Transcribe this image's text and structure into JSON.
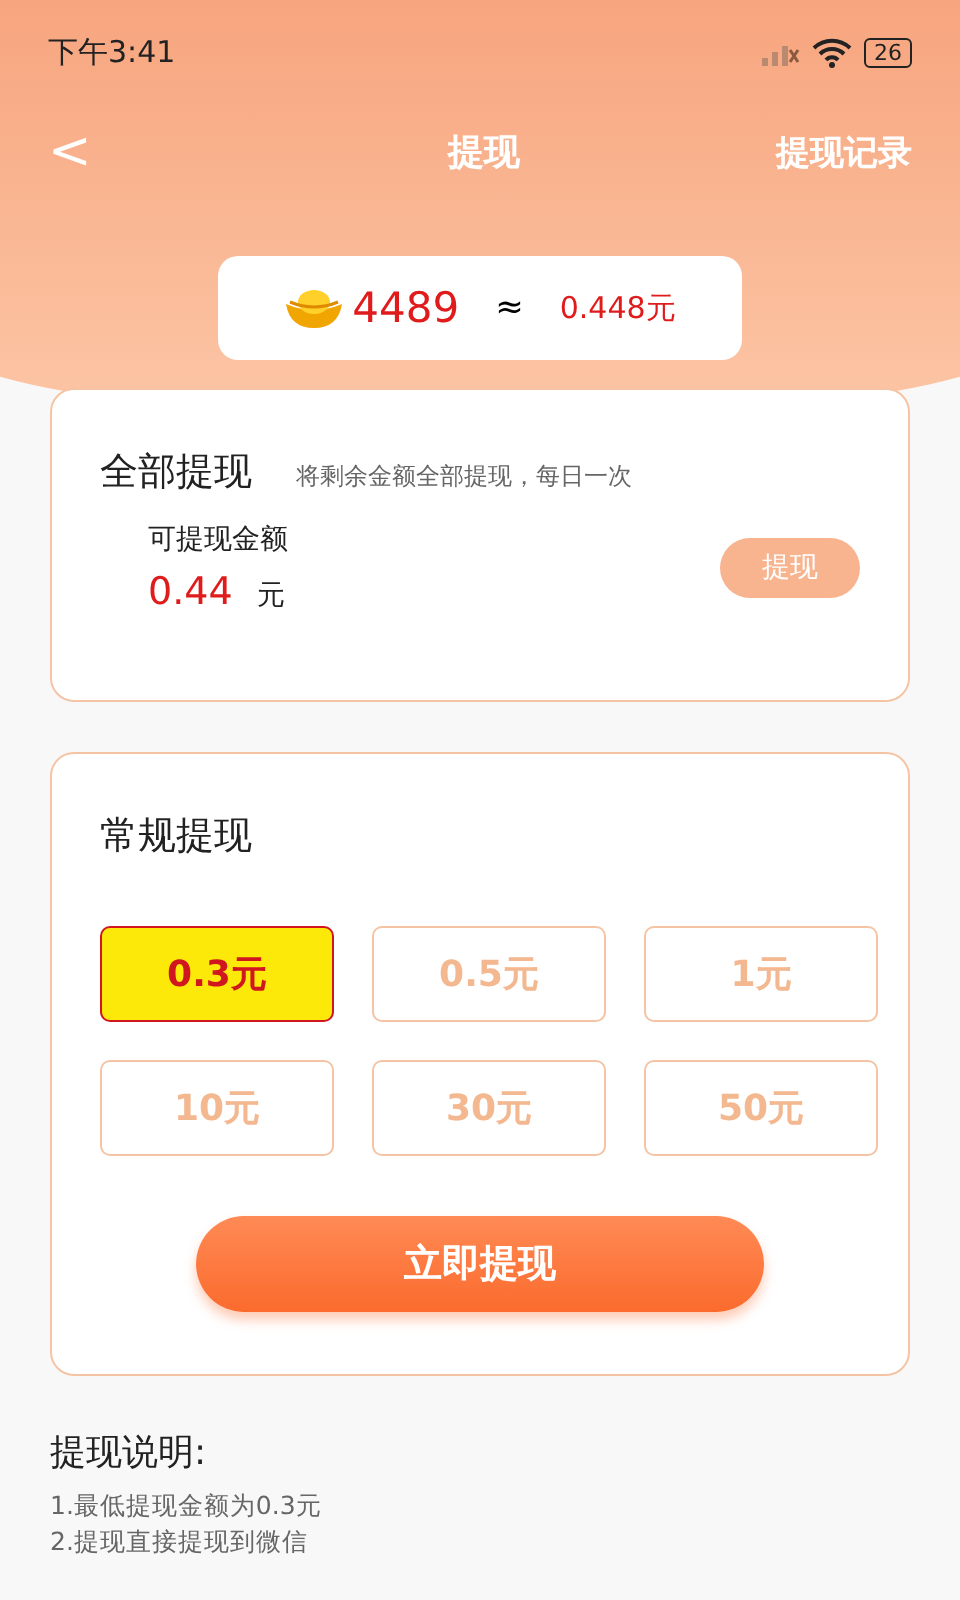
{
  "status_bar": {
    "time": "下午3:41",
    "battery": "26"
  },
  "nav": {
    "back": "<",
    "title": "提现",
    "action": "提现记录"
  },
  "balance": {
    "coins": "4489",
    "approx": "≈",
    "money": "0.448元"
  },
  "all_withdraw": {
    "title": "全部提现",
    "hint": "将剩余金额全部提现，每日一次",
    "amount_label": "可提现金额",
    "amount": "0.44",
    "unit": "元",
    "button": "提现"
  },
  "regular": {
    "title": "常规提现",
    "options": [
      {
        "label": "0.3元",
        "selected": true
      },
      {
        "label": "0.5元",
        "selected": false
      },
      {
        "label": "1元",
        "selected": false
      },
      {
        "label": "10元",
        "selected": false
      },
      {
        "label": "30元",
        "selected": false
      },
      {
        "label": "50元",
        "selected": false
      }
    ],
    "button": "立即提现"
  },
  "notes": {
    "title": "提现说明:",
    "lines": [
      "1.最低提现金额为0.3元",
      "2.提现直接提现到微信"
    ]
  }
}
